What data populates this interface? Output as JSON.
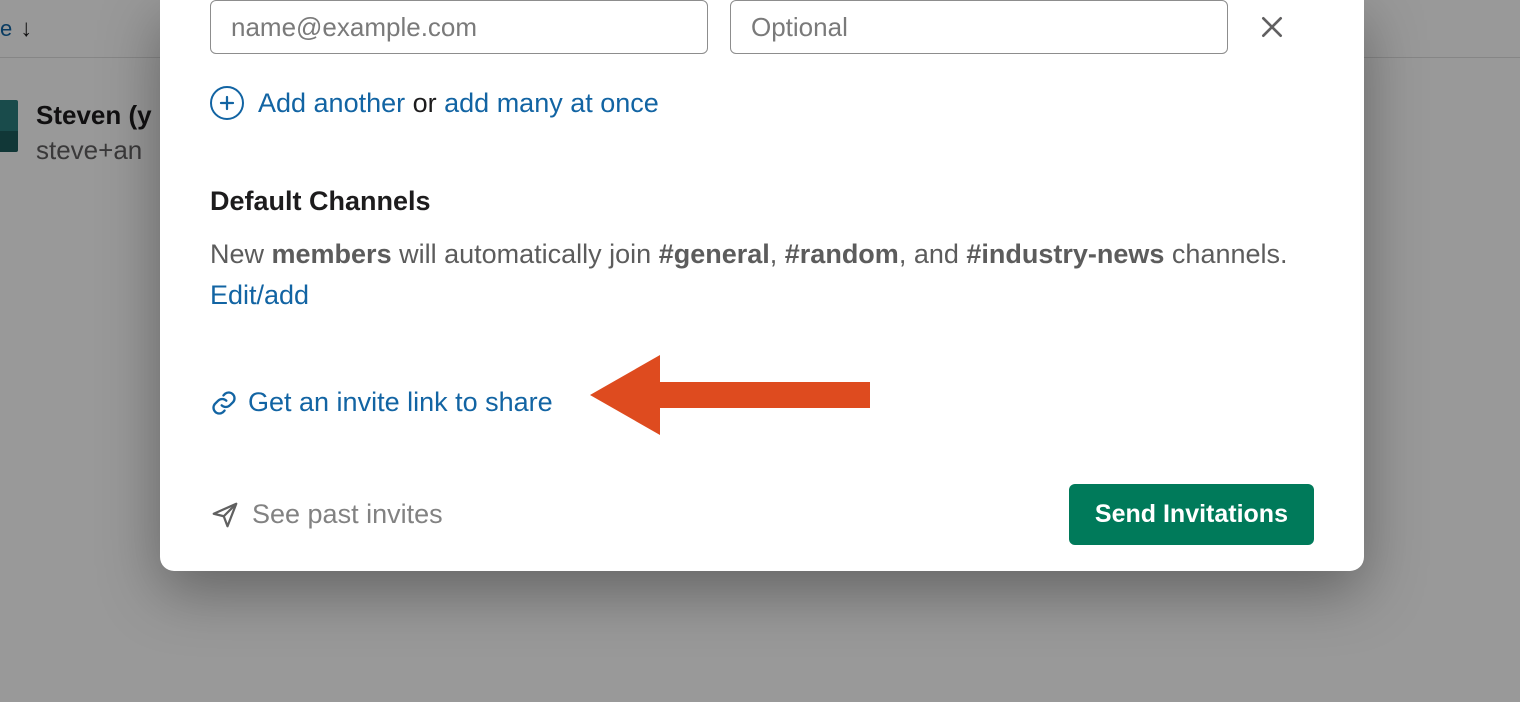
{
  "background": {
    "top_text": "e",
    "profile_name": "Steven (y",
    "profile_email": "steve+an"
  },
  "modal": {
    "email_placeholder": "name@example.com",
    "optional_placeholder": "Optional",
    "add_another": "Add another",
    "or_text": " or ",
    "add_many": "add many at once",
    "default_channels_title": "Default Channels",
    "dc_text1": "New ",
    "dc_members": "members",
    "dc_text2": " will automatically join ",
    "dc_ch1": "#general",
    "dc_sep1": ", ",
    "dc_ch2": "#random",
    "dc_sep2": ", and ",
    "dc_ch3": "#industry-news",
    "dc_text3": " channels.",
    "edit_add": "Edit/add",
    "invite_link": "Get an invite link to share",
    "past_invites": "See past invites",
    "send_button": "Send Invitations"
  }
}
